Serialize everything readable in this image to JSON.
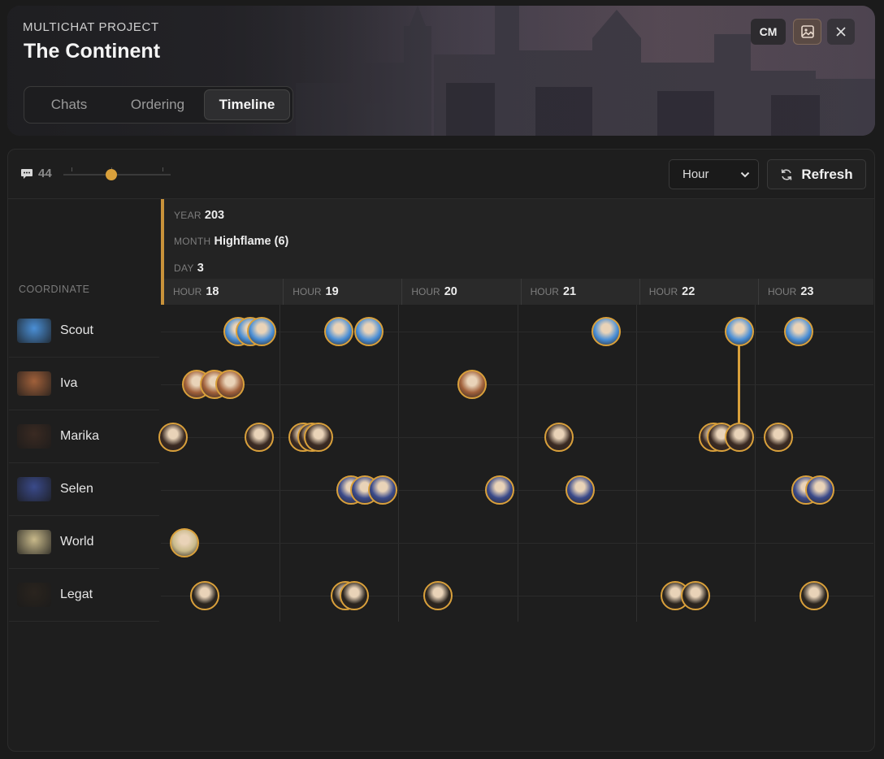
{
  "project": {
    "eyebrow": "MULTICHAT PROJECT",
    "title": "The Continent"
  },
  "tabs": [
    "Chats",
    "Ordering",
    "Timeline"
  ],
  "active_tab": "Timeline",
  "header_buttons": {
    "cm_label": "CM",
    "image_icon": "image-icon",
    "close_icon": "close-icon"
  },
  "toolbar": {
    "message_count": "44",
    "message_icon": "chat-bubble-icon",
    "zoom_slider_fraction": 0.45,
    "granularity_selected": "Hour",
    "refresh_label": "Refresh",
    "refresh_icon": "refresh-icon"
  },
  "timeline": {
    "column_header": "COORDINATE",
    "year_label": "YEAR",
    "year": "203",
    "month_label": "MONTH",
    "month": "Highflame (6)",
    "day_label": "DAY",
    "day": "3",
    "hour_label": "HOUR",
    "hours": [
      "18",
      "19",
      "20",
      "21",
      "22",
      "23"
    ],
    "rows": [
      {
        "name": "Scout",
        "color": "#4a8fd6",
        "events": [
          18.65,
          18.75,
          18.85,
          19.5,
          19.75,
          21.75,
          22.87,
          23.37
        ]
      },
      {
        "name": "Iva",
        "color": "#a0603a",
        "events": [
          18.3,
          18.45,
          18.58,
          20.62
        ]
      },
      {
        "name": "Marika",
        "color": "#3a2a22",
        "events": [
          18.1,
          18.83,
          19.2,
          19.27,
          19.33,
          21.35,
          22.65,
          22.72,
          22.87,
          23.2
        ]
      },
      {
        "name": "Selen",
        "color": "#3a4a8a",
        "events": [
          19.6,
          19.72,
          19.87,
          20.85,
          21.53,
          23.43,
          23.55
        ]
      },
      {
        "name": "World",
        "color": "#c8b98a",
        "events": [
          18.2
        ]
      },
      {
        "name": "Legat",
        "color": "#2a241e",
        "events": [
          18.37,
          19.55,
          19.63,
          20.33,
          22.33,
          22.5,
          23.5
        ]
      }
    ],
    "accent_color": "#d9a03b"
  }
}
